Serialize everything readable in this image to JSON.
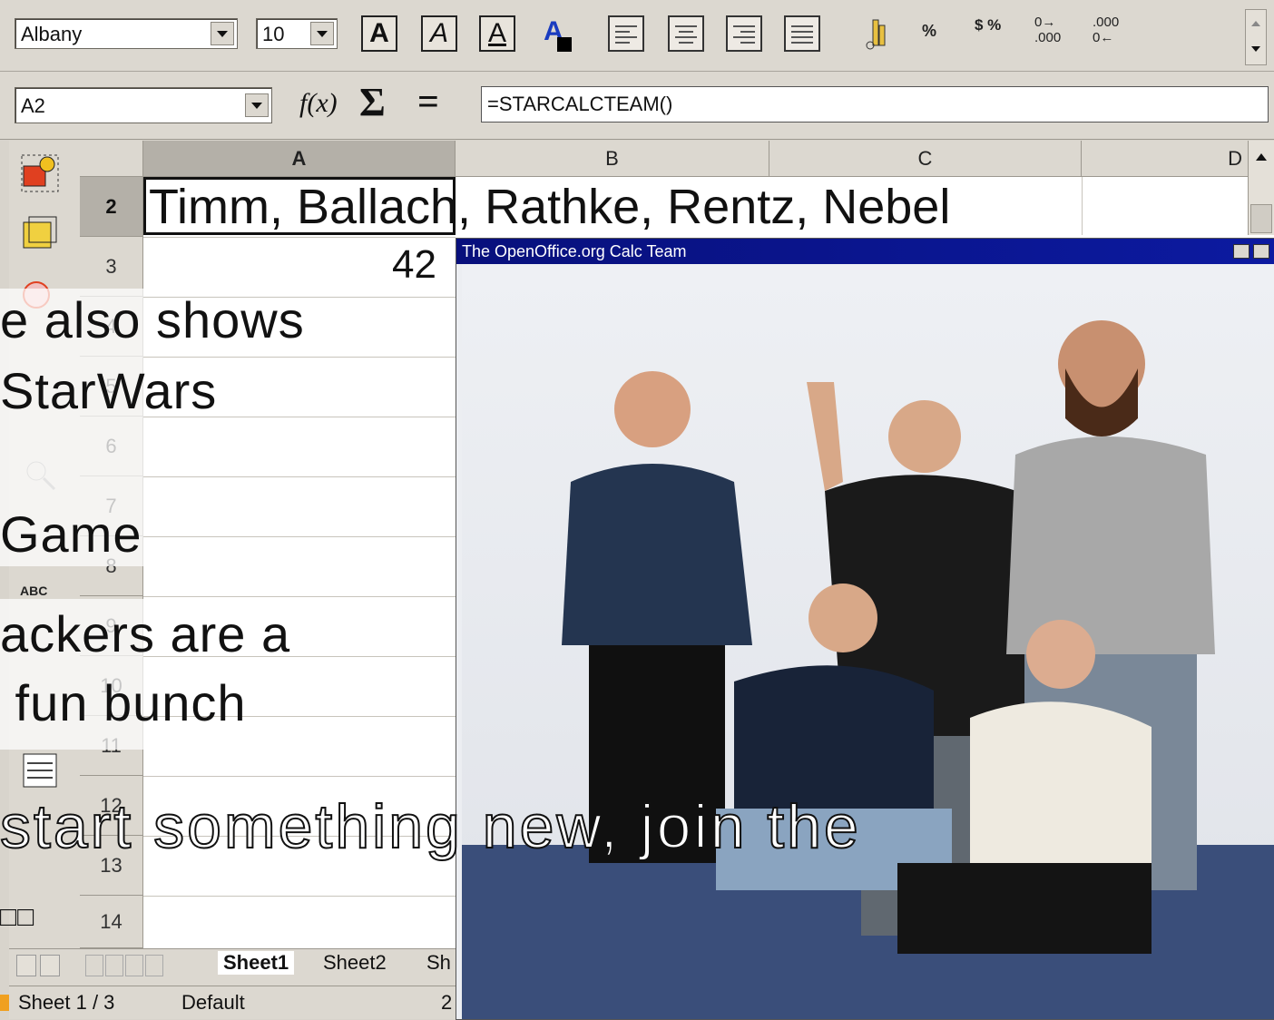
{
  "toolbar": {
    "font_name": "Albany",
    "font_size": "10",
    "bold_label": "A",
    "italic_label": "A",
    "underline_label": "A",
    "color_label": "A",
    "percent_label": "%",
    "currency_label": "$ %",
    "add_decimal_label": "0→ .000",
    "del_decimal_label": ".000 0←"
  },
  "formula": {
    "cell_ref": "A2",
    "fx_label": "f(x)",
    "sum_label": "Σ",
    "equals_label": "=",
    "value": "=STARCALCTEAM()"
  },
  "grid": {
    "columns": [
      "A",
      "B",
      "C",
      "D"
    ],
    "rows": [
      "2",
      "3",
      "4",
      "5",
      "6",
      "7",
      "8",
      "9",
      "10",
      "11",
      "12",
      "13",
      "14"
    ],
    "a2_value": "Timm, Ballach, Rathke, Rentz, Nebel",
    "a3_value": "42"
  },
  "photo_window": {
    "title": "The OpenOffice.org Calc Team"
  },
  "tabs": [
    "Sheet1",
    "Sheet2",
    "Sh"
  ],
  "status": {
    "sheet": "Sheet 1 / 3",
    "style": "Default",
    "zoom": "2"
  },
  "slide_overlay": {
    "line1": "e also shows",
    "line2": "StarWars",
    "line3": "Game",
    "line4": "ackers are a",
    "line5": " fun bunch",
    "outline_line": "start something new, join the",
    "trailing": "□□"
  }
}
